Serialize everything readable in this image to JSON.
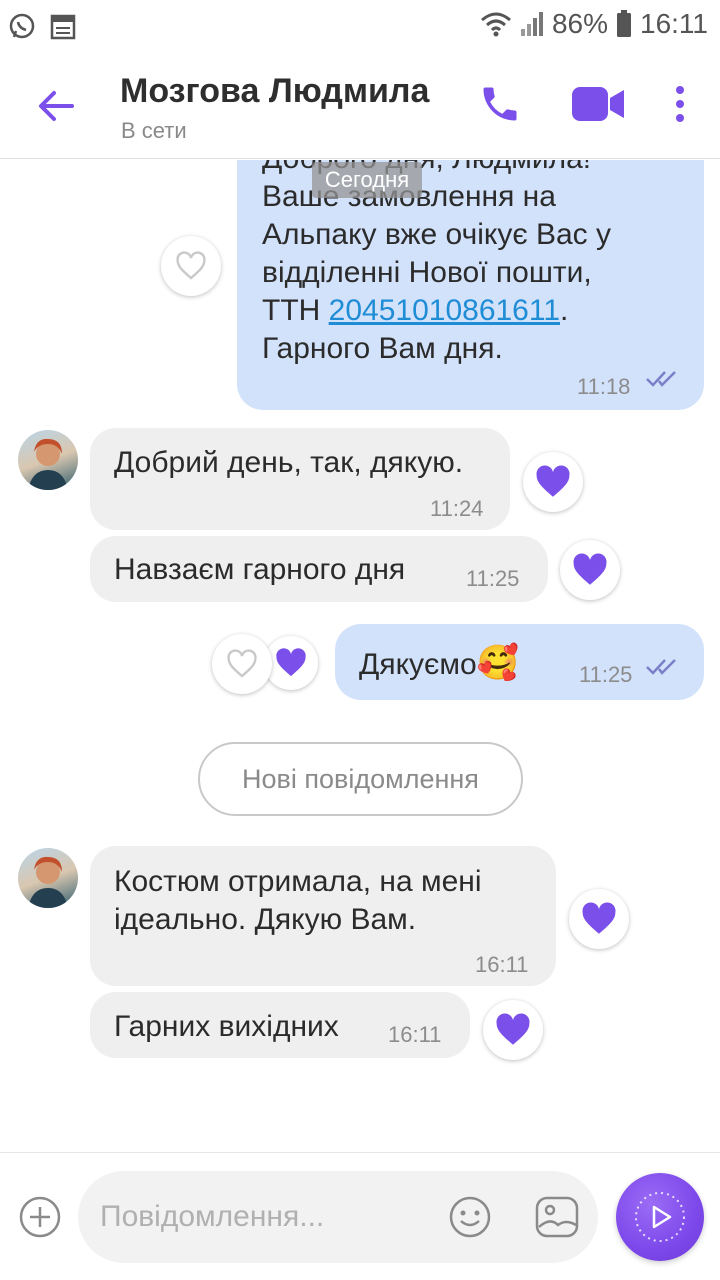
{
  "status_bar": {
    "battery": "86%",
    "time": "16:11",
    "icons": [
      "whatsapp-icon",
      "calendar-icon",
      "wifi-icon",
      "signal-icon",
      "battery-icon"
    ]
  },
  "header": {
    "name": "Мозгова Людмила",
    "status": "В сети",
    "icons": [
      "back-arrow-icon",
      "phone-icon",
      "video-camera-icon",
      "more-vertical-icon"
    ]
  },
  "chat": {
    "date_pill": "Сегодня",
    "msg1": {
      "line0": "Доброго дня, Людмила!",
      "line1": "Ваше замовлення на",
      "line2": "Альпаку вже очікує Вас у",
      "line3": "відділенні Нової пошти,",
      "line4_prefix": "ТТН ",
      "ttn": "20451010861611",
      "line4_suffix": ".",
      "line5": "Гарного Вам дня.",
      "time": "11:18"
    },
    "msg2": {
      "text": "Добрий день, так, дякую.",
      "time": "11:24"
    },
    "msg3": {
      "text": "Навзаєм гарного дня",
      "time": "11:25"
    },
    "msg4": {
      "text": "Дякуємо",
      "emoji": "🥰",
      "time": "11:25"
    },
    "new_messages": "Нові повідомлення",
    "msg5": {
      "line1": "Костюм отримала, на мені",
      "line2": "ідеально. Дякую Вам.",
      "time": "16:11"
    },
    "msg6": {
      "text": "Гарних вихідних",
      "time": "16:11"
    }
  },
  "composer": {
    "placeholder": "Повідомлення...",
    "icons": [
      "add-icon",
      "emoji-icon",
      "gallery-icon",
      "send-icon"
    ]
  },
  "colors": {
    "accent": "#7b4fe9",
    "outgoing_bubble": "#d3e2fb",
    "incoming_bubble": "#efefef",
    "link": "#1f8dd6"
  }
}
